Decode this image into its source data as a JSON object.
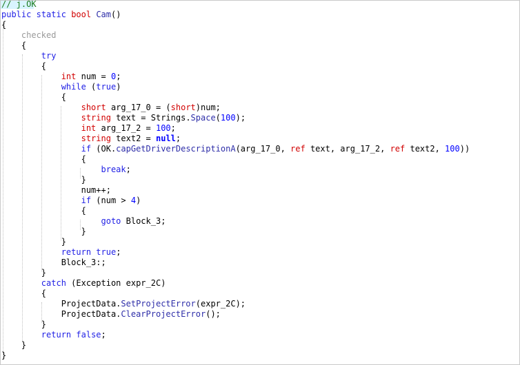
{
  "window": {
    "comment": "// j.OK"
  },
  "code_lines": [
    {
      "tokens": [
        {
          "t": "// j.OK",
          "c": "cm"
        }
      ]
    },
    {
      "tokens": [
        {
          "t": "public",
          "c": "kw"
        },
        {
          "t": " ",
          "c": "plain"
        },
        {
          "t": "static",
          "c": "kw"
        },
        {
          "t": " ",
          "c": "plain"
        },
        {
          "t": "bool",
          "c": "ty"
        },
        {
          "t": " ",
          "c": "plain"
        },
        {
          "t": "Cam",
          "c": "fn"
        },
        {
          "t": "()",
          "c": "plain"
        }
      ]
    },
    {
      "tokens": [
        {
          "t": "{",
          "c": "plain"
        }
      ]
    },
    {
      "tokens": [
        {
          "t": "    checked",
          "c": "dim"
        }
      ]
    },
    {
      "tokens": [
        {
          "t": "    {",
          "c": "plain"
        }
      ]
    },
    {
      "tokens": [
        {
          "t": "        ",
          "c": "plain"
        },
        {
          "t": "try",
          "c": "kw"
        }
      ]
    },
    {
      "tokens": [
        {
          "t": "        {",
          "c": "plain"
        }
      ]
    },
    {
      "tokens": [
        {
          "t": "            ",
          "c": "plain"
        },
        {
          "t": "int",
          "c": "ty"
        },
        {
          "t": " num = ",
          "c": "plain"
        },
        {
          "t": "0",
          "c": "num"
        },
        {
          "t": ";",
          "c": "plain"
        }
      ]
    },
    {
      "tokens": [
        {
          "t": "            ",
          "c": "plain"
        },
        {
          "t": "while",
          "c": "kw"
        },
        {
          "t": " (",
          "c": "plain"
        },
        {
          "t": "true",
          "c": "kw"
        },
        {
          "t": ")",
          "c": "plain"
        }
      ]
    },
    {
      "tokens": [
        {
          "t": "            {",
          "c": "plain"
        }
      ]
    },
    {
      "tokens": [
        {
          "t": "                ",
          "c": "plain"
        },
        {
          "t": "short",
          "c": "ty"
        },
        {
          "t": " arg_17_0 = (",
          "c": "plain"
        },
        {
          "t": "short",
          "c": "ty"
        },
        {
          "t": ")num;",
          "c": "plain"
        }
      ]
    },
    {
      "tokens": [
        {
          "t": "                ",
          "c": "plain"
        },
        {
          "t": "string",
          "c": "ty"
        },
        {
          "t": " text = Strings.",
          "c": "plain"
        },
        {
          "t": "Space",
          "c": "fn"
        },
        {
          "t": "(",
          "c": "plain"
        },
        {
          "t": "100",
          "c": "num"
        },
        {
          "t": ");",
          "c": "plain"
        }
      ]
    },
    {
      "tokens": [
        {
          "t": "                ",
          "c": "plain"
        },
        {
          "t": "int",
          "c": "ty"
        },
        {
          "t": " arg_17_2 = ",
          "c": "plain"
        },
        {
          "t": "100",
          "c": "num"
        },
        {
          "t": ";",
          "c": "plain"
        }
      ]
    },
    {
      "tokens": [
        {
          "t": "                ",
          "c": "plain"
        },
        {
          "t": "string",
          "c": "ty"
        },
        {
          "t": " text2 = ",
          "c": "plain"
        },
        {
          "t": "null",
          "c": "kwb"
        },
        {
          "t": ";",
          "c": "plain"
        }
      ]
    },
    {
      "tokens": [
        {
          "t": "                ",
          "c": "plain"
        },
        {
          "t": "if",
          "c": "kw"
        },
        {
          "t": " (OK.",
          "c": "plain"
        },
        {
          "t": "capGetDriverDescriptionA",
          "c": "fn"
        },
        {
          "t": "(arg_17_0, ",
          "c": "plain"
        },
        {
          "t": "ref",
          "c": "ty"
        },
        {
          "t": " text, arg_17_2, ",
          "c": "plain"
        },
        {
          "t": "ref",
          "c": "ty"
        },
        {
          "t": " text2, ",
          "c": "plain"
        },
        {
          "t": "100",
          "c": "num"
        },
        {
          "t": "))",
          "c": "plain"
        }
      ]
    },
    {
      "tokens": [
        {
          "t": "                {",
          "c": "plain"
        }
      ]
    },
    {
      "tokens": [
        {
          "t": "                    ",
          "c": "plain"
        },
        {
          "t": "break",
          "c": "kw"
        },
        {
          "t": ";",
          "c": "plain"
        }
      ]
    },
    {
      "tokens": [
        {
          "t": "                }",
          "c": "plain"
        }
      ]
    },
    {
      "tokens": [
        {
          "t": "                num++;",
          "c": "plain"
        }
      ]
    },
    {
      "tokens": [
        {
          "t": "                ",
          "c": "plain"
        },
        {
          "t": "if",
          "c": "kw"
        },
        {
          "t": " (num > ",
          "c": "plain"
        },
        {
          "t": "4",
          "c": "num"
        },
        {
          "t": ")",
          "c": "plain"
        }
      ]
    },
    {
      "tokens": [
        {
          "t": "                {",
          "c": "plain"
        }
      ]
    },
    {
      "tokens": [
        {
          "t": "                    ",
          "c": "plain"
        },
        {
          "t": "goto",
          "c": "kw"
        },
        {
          "t": " Block_3;",
          "c": "plain"
        }
      ]
    },
    {
      "tokens": [
        {
          "t": "                }",
          "c": "plain"
        }
      ]
    },
    {
      "tokens": [
        {
          "t": "            }",
          "c": "plain"
        }
      ]
    },
    {
      "tokens": [
        {
          "t": "            ",
          "c": "plain"
        },
        {
          "t": "return",
          "c": "kw"
        },
        {
          "t": " ",
          "c": "plain"
        },
        {
          "t": "true",
          "c": "kw"
        },
        {
          "t": ";",
          "c": "plain"
        }
      ]
    },
    {
      "tokens": [
        {
          "t": "            Block_3:;",
          "c": "plain"
        }
      ]
    },
    {
      "tokens": [
        {
          "t": "        }",
          "c": "plain"
        }
      ]
    },
    {
      "tokens": [
        {
          "t": "        ",
          "c": "plain"
        },
        {
          "t": "catch",
          "c": "kw"
        },
        {
          "t": " (Exception expr_2C)",
          "c": "plain"
        }
      ]
    },
    {
      "tokens": [
        {
          "t": "        {",
          "c": "plain"
        }
      ]
    },
    {
      "tokens": [
        {
          "t": "            ProjectData.",
          "c": "plain"
        },
        {
          "t": "SetProjectError",
          "c": "fn"
        },
        {
          "t": "(expr_2C);",
          "c": "plain"
        }
      ]
    },
    {
      "tokens": [
        {
          "t": "            ProjectData.",
          "c": "plain"
        },
        {
          "t": "ClearProjectError",
          "c": "fn"
        },
        {
          "t": "();",
          "c": "plain"
        }
      ]
    },
    {
      "tokens": [
        {
          "t": "        }",
          "c": "plain"
        }
      ]
    },
    {
      "tokens": [
        {
          "t": "        ",
          "c": "plain"
        },
        {
          "t": "return",
          "c": "kw"
        },
        {
          "t": " ",
          "c": "plain"
        },
        {
          "t": "false",
          "c": "kw"
        },
        {
          "t": ";",
          "c": "plain"
        }
      ]
    },
    {
      "tokens": [
        {
          "t": "    }",
          "c": "plain"
        }
      ]
    },
    {
      "tokens": [
        {
          "t": "}",
          "c": "plain"
        }
      ]
    }
  ],
  "colors": {
    "keyword": "#1f1fe5",
    "type": "#d10000",
    "comment": "#1c7c1c",
    "function": "#2d2da8",
    "number": "#0000ff",
    "dimmed": "#9a9a9a",
    "guide": "#c0c0c0",
    "current_line_marker": "#d9f4ff"
  }
}
